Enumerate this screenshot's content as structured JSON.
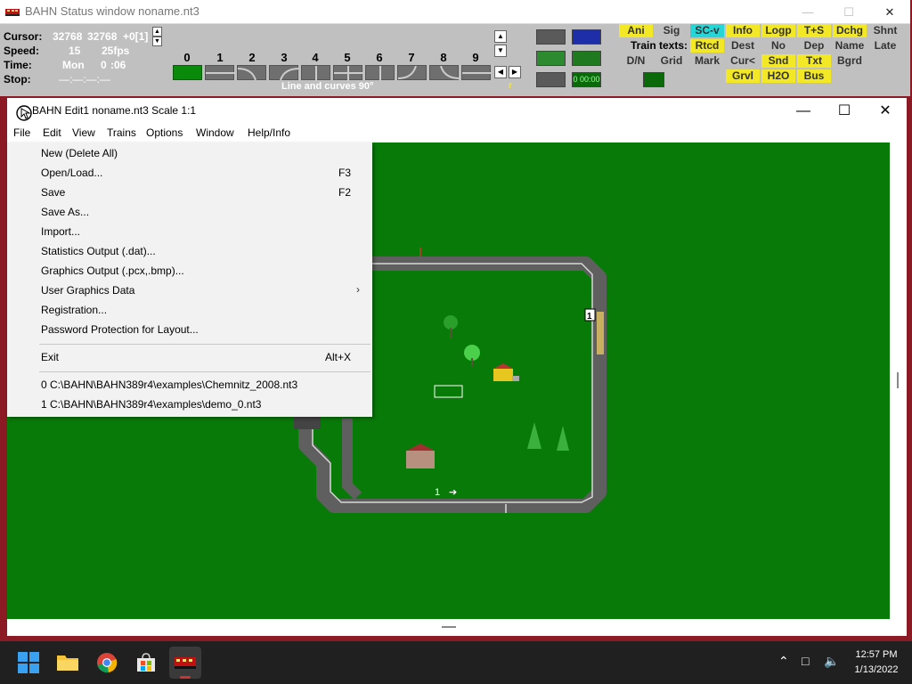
{
  "status_window": {
    "title": "BAHN Status window noname.nt3",
    "labels": {
      "cursor": "Cursor:",
      "speed": "Speed:",
      "time": "Time:",
      "stop": "Stop:"
    },
    "values": {
      "cursor_x": "32768",
      "cursor_y": "32768",
      "cursor_offset": "+0[1]",
      "speed": "15",
      "fps": "25fps",
      "day": "Mon",
      "hour": "0",
      "minute": ":06",
      "stop": "—:—:—:—"
    },
    "track_numbers": [
      "0",
      "1",
      "2",
      "3",
      "4",
      "5",
      "6",
      "7",
      "8",
      "9"
    ],
    "track_caption": "Line and curves 90°",
    "track_caption_right": "r",
    "clock_display": "0 00:00",
    "train_texts_label": "Train texts:",
    "buttons_row1": [
      "Ani",
      "Sig",
      "SC-v",
      "Info",
      "Logp",
      "T+S",
      "Dchg",
      "Shnt"
    ],
    "buttons_row2": [
      "Rtcd",
      "Dest",
      "No",
      "Dep",
      "Name",
      "Late"
    ],
    "buttons_row3": [
      "D/N",
      "Grid",
      "Mark",
      "Cur<",
      "Snd",
      "Txt",
      "Bgrd"
    ],
    "buttons_row4": [
      "Grvl",
      "H2O",
      "Bus"
    ]
  },
  "edit_window": {
    "title": "BAHN Edit1 noname.nt3 Scale 1:1",
    "menu": [
      "File",
      "Edit",
      "View",
      "Trains",
      "Options",
      "Window",
      "Help/Info"
    ],
    "canvas_labels": {
      "track_marker": "1",
      "signal_number": "1"
    }
  },
  "file_menu": {
    "items": [
      {
        "label": "New (Delete All)",
        "key": ""
      },
      {
        "label": "Open/Load...",
        "key": "F3"
      },
      {
        "label": "Save",
        "key": "F2"
      },
      {
        "label": "Save As...",
        "key": ""
      },
      {
        "label": "Import...",
        "key": ""
      },
      {
        "label": "Statistics Output (.dat)...",
        "key": ""
      },
      {
        "label": "Graphics Output (.pcx,.bmp)...",
        "key": ""
      },
      {
        "label": "User Graphics Data",
        "key": ""
      },
      {
        "label": "Registration...",
        "key": ""
      },
      {
        "label": "Password Protection for Layout...",
        "key": ""
      }
    ],
    "exit": {
      "label": "Exit",
      "key": "Alt+X"
    },
    "recent": [
      "0 C:\\BAHN\\BAHN389r4\\examples\\Chemnitz_2008.nt3",
      "1 C:\\BAHN\\BAHN389r4\\examples\\demo_0.nt3"
    ]
  },
  "taskbar": {
    "time": "12:57 PM",
    "date": "1/13/2022"
  },
  "colors": {
    "desktop": "#8b1a24",
    "canvas": "#087a08",
    "status_bg": "#c0c0c0",
    "button_yellow": "#f2e826",
    "button_cyan": "#26d6d6",
    "track_gray": "#5f5f5f"
  }
}
